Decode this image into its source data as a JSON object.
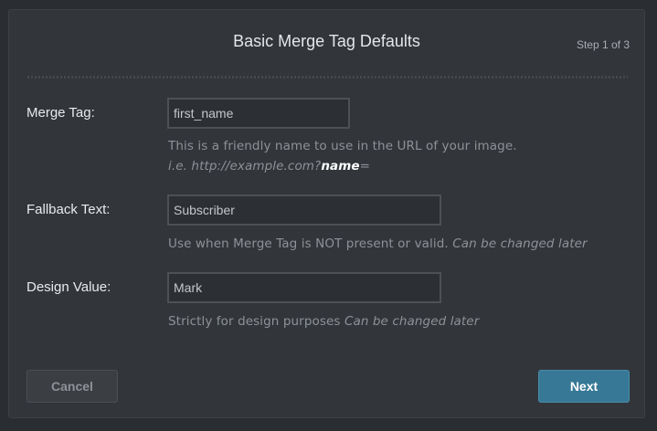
{
  "dialog": {
    "title": "Basic Merge Tag Defaults",
    "step": "Step 1 of 3"
  },
  "fields": {
    "merge_tag": {
      "label": "Merge Tag:",
      "value": "first_name",
      "help_line1": "This is a friendly name to use in the URL of your image.",
      "help_line2_prefix": "i.e. http://example.com?",
      "help_line2_bold": "name",
      "help_line2_suffix": "="
    },
    "fallback_text": {
      "label": "Fallback Text:",
      "value": "Subscriber",
      "help_main": "Use when Merge Tag is NOT present or valid.",
      "help_italic": "Can be changed later"
    },
    "design_value": {
      "label": "Design Value:",
      "value": "Mark",
      "help_main": "Strictly for design purposes",
      "help_italic": "Can be changed later"
    }
  },
  "buttons": {
    "cancel": "Cancel",
    "next": "Next"
  },
  "colors": {
    "background": "#2a2d31",
    "panel": "#32363b",
    "primary_button": "#377896"
  }
}
